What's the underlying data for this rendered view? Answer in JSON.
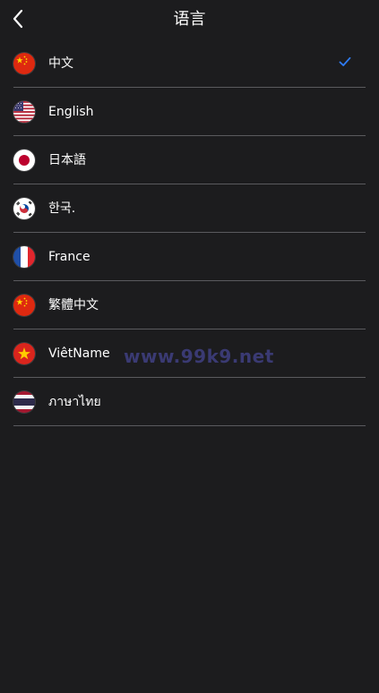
{
  "header": {
    "title": "语言"
  },
  "languages": [
    {
      "label": "中文",
      "flag": "china-flag-icon",
      "selected": true
    },
    {
      "label": "English",
      "flag": "usa-flag-icon",
      "selected": false
    },
    {
      "label": "日本語",
      "flag": "japan-flag-icon",
      "selected": false
    },
    {
      "label": "한국.",
      "flag": "korea-flag-icon",
      "selected": false
    },
    {
      "label": "France",
      "flag": "france-flag-icon",
      "selected": false
    },
    {
      "label": "繁體中文",
      "flag": "china-flag-icon",
      "selected": false
    },
    {
      "label": "ViêtName",
      "flag": "vietnam-flag-icon",
      "selected": false
    },
    {
      "label": "ภาษาไทย",
      "flag": "thailand-flag-icon",
      "selected": false
    }
  ],
  "watermark": "www.99k9.net",
  "colors": {
    "background": "#1c1c1e",
    "divider": "#5a5a5e",
    "check": "#2f7cf6",
    "watermark": "#3c3c78"
  }
}
